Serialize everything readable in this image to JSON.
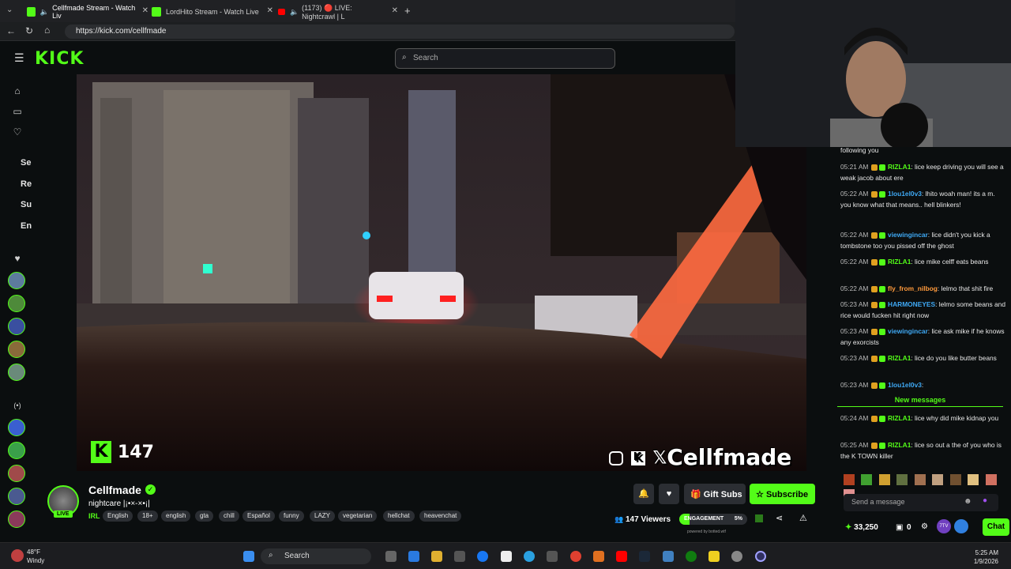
{
  "browser": {
    "tabs": [
      {
        "label": "Cellfmade Stream - Watch Liv",
        "active": true
      },
      {
        "label": "LordHito Stream - Watch Live",
        "active": false
      },
      {
        "label": "(1173) 🔴 LIVE: Nightcrawl | L",
        "active": false
      }
    ],
    "new_tab_icon": "plus-icon",
    "url": "https://kick.com/cellfmade"
  },
  "header": {
    "logo": "KICK",
    "search_placeholder": "Search"
  },
  "sidebar": {
    "labels": [
      "Se",
      "Re",
      "Su",
      "En"
    ]
  },
  "video": {
    "kick_viewer_overlay": "147",
    "watermark": "Cellfmade"
  },
  "stream": {
    "name": "Cellfmade",
    "title": "nightcare |¡•×-×•¡|",
    "live_label": "LIVE",
    "category": "IRL",
    "tags": [
      "English",
      "18+",
      "english",
      "gta",
      "chill",
      "Español",
      "funny",
      "LAZY",
      "vegetarian",
      "hellchat",
      "heavenchat"
    ],
    "gift_label": "Gift Subs",
    "subscribe_label": "Subscribe",
    "viewers": "147 Viewers",
    "engagement_label": "ENGAGEMENT",
    "engagement_pct": "5%",
    "engagement_value": 0.05,
    "powered_by": "powered by botted.wtf"
  },
  "chat": {
    "first_line": "following you",
    "messages": [
      {
        "time": "05:21 AM",
        "user": "RIZLA1",
        "color": "#53fc18",
        "text": "lice keep driving you will see a weak jacob about ere"
      },
      {
        "time": "05:22 AM",
        "user": "1lou1el0v3",
        "color": "#3fa9f5",
        "text": "lhito woah man! its  a m. you know what that means.. hell blinkers!"
      },
      {
        "time": "05:22 AM",
        "user": "viewingincar",
        "color": "#3fa9f5",
        "text": "lice didn't you kick a tombstone too you pissed off the ghost"
      },
      {
        "time": "05:22 AM",
        "user": "RIZLA1",
        "color": "#53fc18",
        "text": "lice mike celff eats beans"
      },
      {
        "time": "05:22 AM",
        "user": "fly_from_nilbog",
        "color": "#ff9a3c",
        "text": "lelmo that shit fire"
      },
      {
        "time": "05:23 AM",
        "user": "HARMONEYES",
        "color": "#3fa9f5",
        "text": "lelmo some beans and rice would fucken hit right now"
      },
      {
        "time": "05:23 AM",
        "user": "viewingincar",
        "color": "#3fa9f5",
        "text": "lice ask mike if he knows any exorcists"
      },
      {
        "time": "05:23 AM",
        "user": "RIZLA1",
        "color": "#53fc18",
        "text": "lice do you like butter beans"
      },
      {
        "time": "05:23 AM",
        "user": "1lou1el0v3",
        "color": "#3fa9f5",
        "text": ""
      }
    ],
    "new_messages_label": "New messages",
    "new_messages": [
      {
        "time": "05:24 AM",
        "user": "RIZLA1",
        "color": "#53fc18",
        "text": "lice why did mike kidnap you"
      },
      {
        "time": "05:25 AM",
        "user": "RIZLA1",
        "color": "#53fc18",
        "text": "lice so out a the of you who is the K TOWN killer"
      }
    ],
    "input_placeholder": "Send a message",
    "points": "33,250",
    "gift_count": "0",
    "chat_button": "Chat"
  },
  "taskbar": {
    "weather_temp": "48°F",
    "weather_desc": "Windy",
    "search": "Search",
    "time": "5:25 AM",
    "date": "1/9/2026"
  }
}
